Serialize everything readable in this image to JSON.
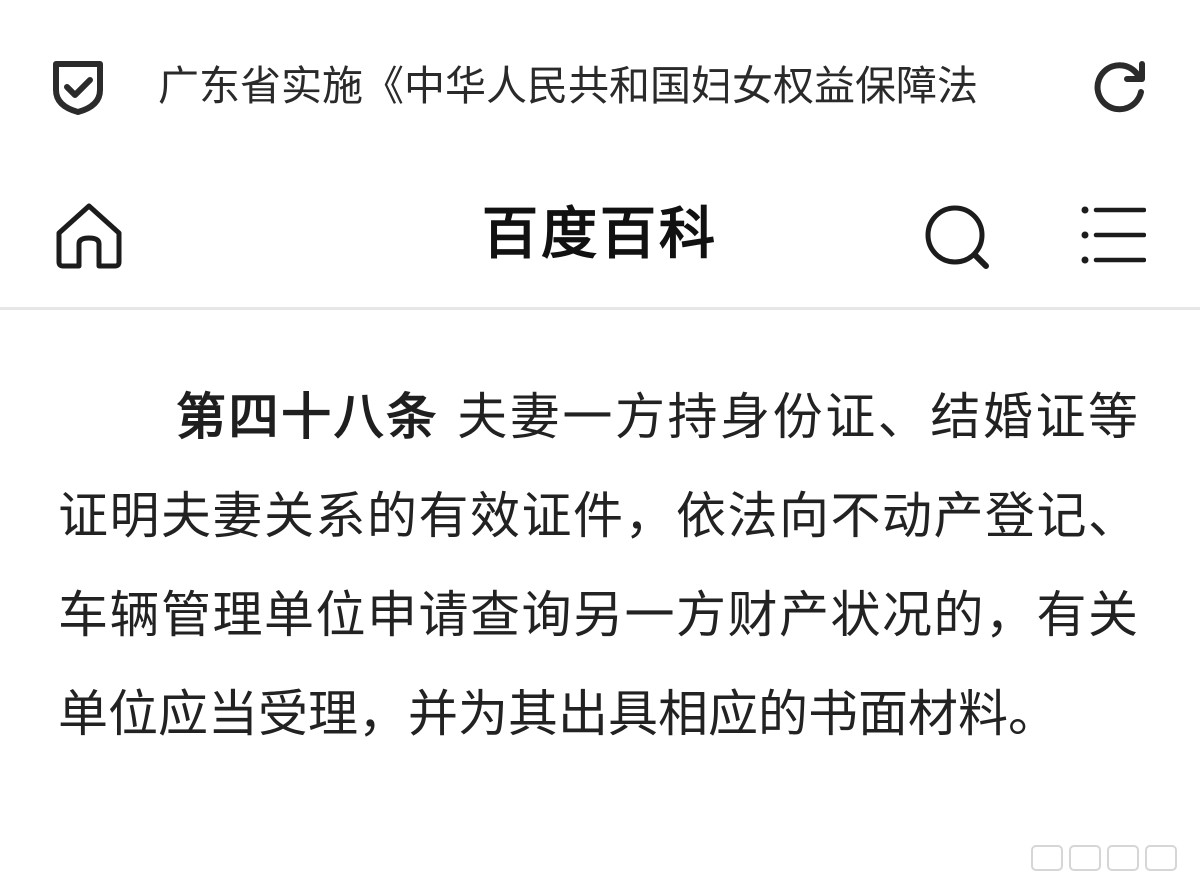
{
  "address_bar": {
    "title": "广东省实施《中华人民共和国妇女权益保障法",
    "security_icon": "shield-check-icon",
    "reload_icon": "reload-icon"
  },
  "header": {
    "site_title": "百度百科",
    "home_icon": "home-icon",
    "search_icon": "search-icon",
    "menu_icon": "menu-icon"
  },
  "article": {
    "label": "第四十八条",
    "text": "夫妻一方持身份证、结婚证等证明夫妻关系的有效证件，依法向不动产登记、车辆管理单位申请查询另一方财产状况的，有关单位应当受理，并为其出具相应的书面材料。"
  },
  "colors": {
    "text": "#222222",
    "divider": "#e6e6e6",
    "background": "#ffffff"
  }
}
